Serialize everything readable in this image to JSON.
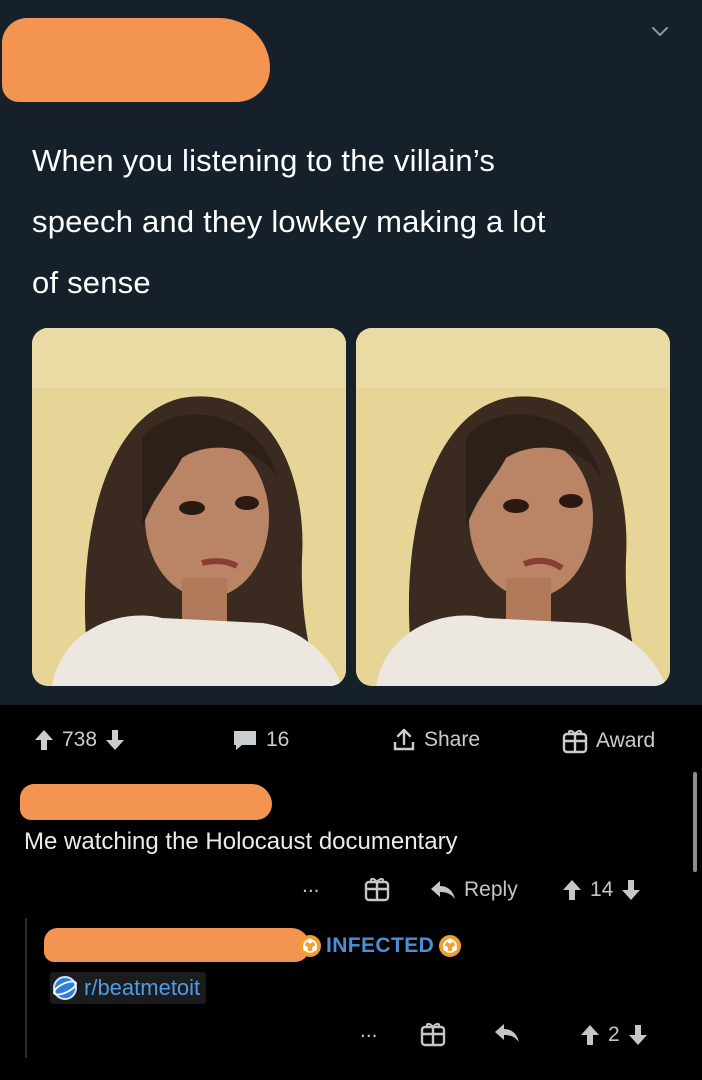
{
  "tweet": {
    "text": "When you listening to the villain’s speech and they lowkey making a lot of sense",
    "line1": "When you listening to the villain’s",
    "line2": "speech and they lowkey making a lot",
    "line3": "of sense",
    "icon_more": "chevron-down-icon"
  },
  "post_actions": {
    "upvotes": "738",
    "comments": "16",
    "share_label": "Share",
    "award_label": "Award"
  },
  "comment_1": {
    "text": "Me watching the Holocaust documentary",
    "more": "...",
    "reply_label": "Reply",
    "score": "14"
  },
  "comment_2": {
    "flair": "INFECTED",
    "subreddit_tag": "r/beatmetoit",
    "more": "...",
    "score": "2"
  },
  "colors": {
    "tweet_bg": "#15202b",
    "page_bg": "#000000",
    "redaction": "#f39550",
    "flair_blue": "#4a8fd8",
    "infected_orange": "#f0a030"
  }
}
